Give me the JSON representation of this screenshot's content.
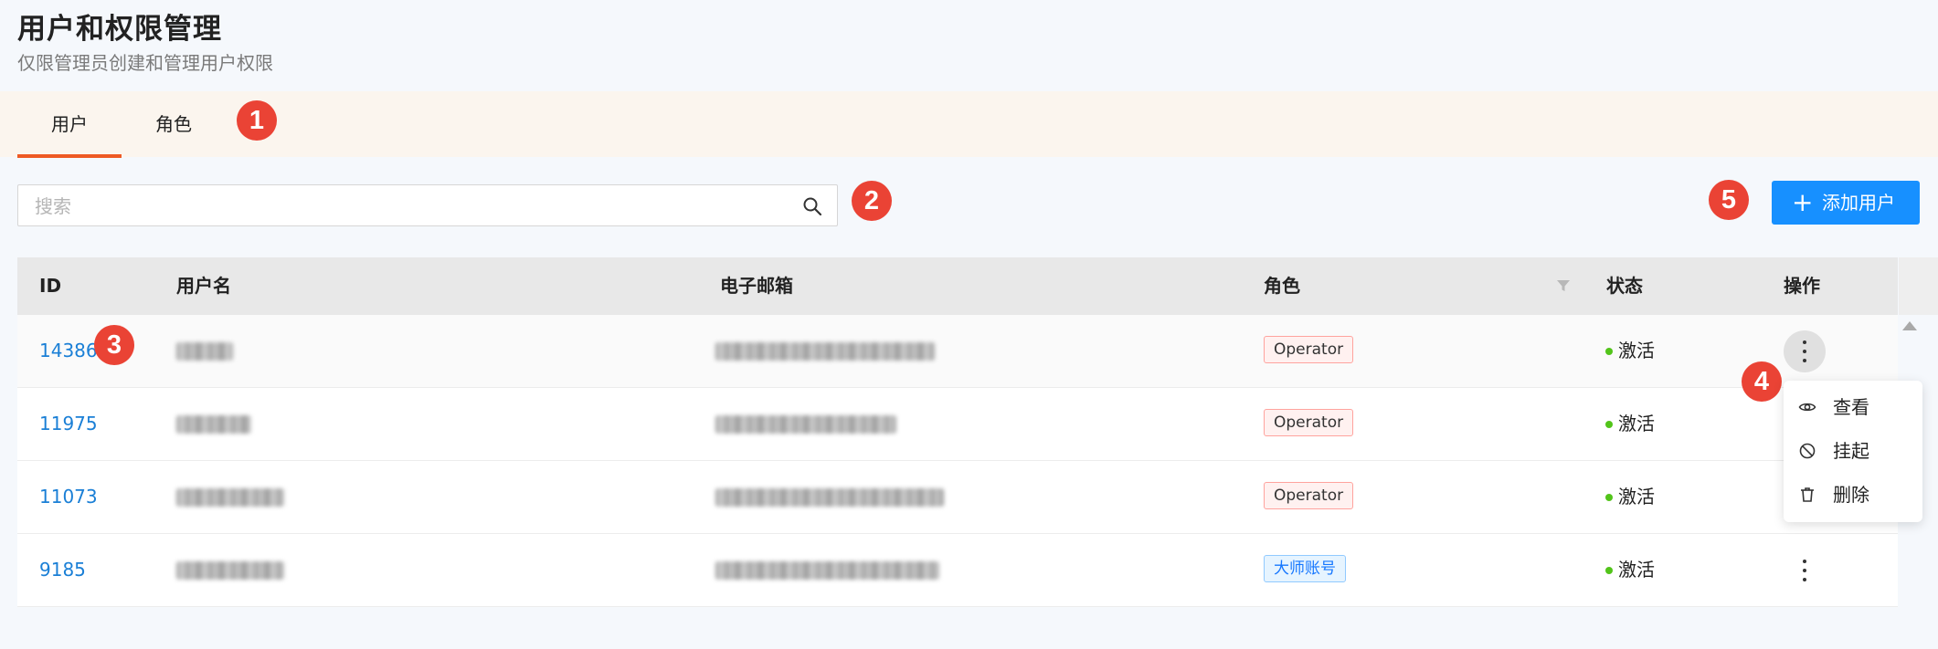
{
  "page": {
    "title": "用户和权限管理",
    "subtitle": "仅限管理员创建和管理用户权限"
  },
  "tabs": [
    {
      "label": "用户",
      "active": true
    },
    {
      "label": "角色",
      "active": false
    }
  ],
  "search": {
    "placeholder": "搜索",
    "value": ""
  },
  "add_user_button": {
    "label": "添加用户"
  },
  "table": {
    "columns": [
      "ID",
      "用户名",
      "电子邮箱",
      "角色",
      "状态",
      "操作"
    ],
    "rows": [
      {
        "id": "14386",
        "role": "Operator",
        "status": "激活"
      },
      {
        "id": "11975",
        "role": "Operator",
        "status": "激活"
      },
      {
        "id": "11073",
        "role": "Operator",
        "status": "激活"
      },
      {
        "id": "9185",
        "role": "大师账号",
        "status": "激活"
      }
    ]
  },
  "row_menu": {
    "items": [
      {
        "label": "查看",
        "icon": "eye-icon"
      },
      {
        "label": "挂起",
        "icon": "ban-icon"
      },
      {
        "label": "删除",
        "icon": "trash-icon"
      }
    ]
  },
  "annotations": [
    "1",
    "2",
    "3",
    "4",
    "5"
  ],
  "colors": {
    "accent": "#ee5a24",
    "primary": "#1790ff",
    "link": "#1a7fd6",
    "badge": "#ea4335",
    "status_active": "#52c41a"
  }
}
